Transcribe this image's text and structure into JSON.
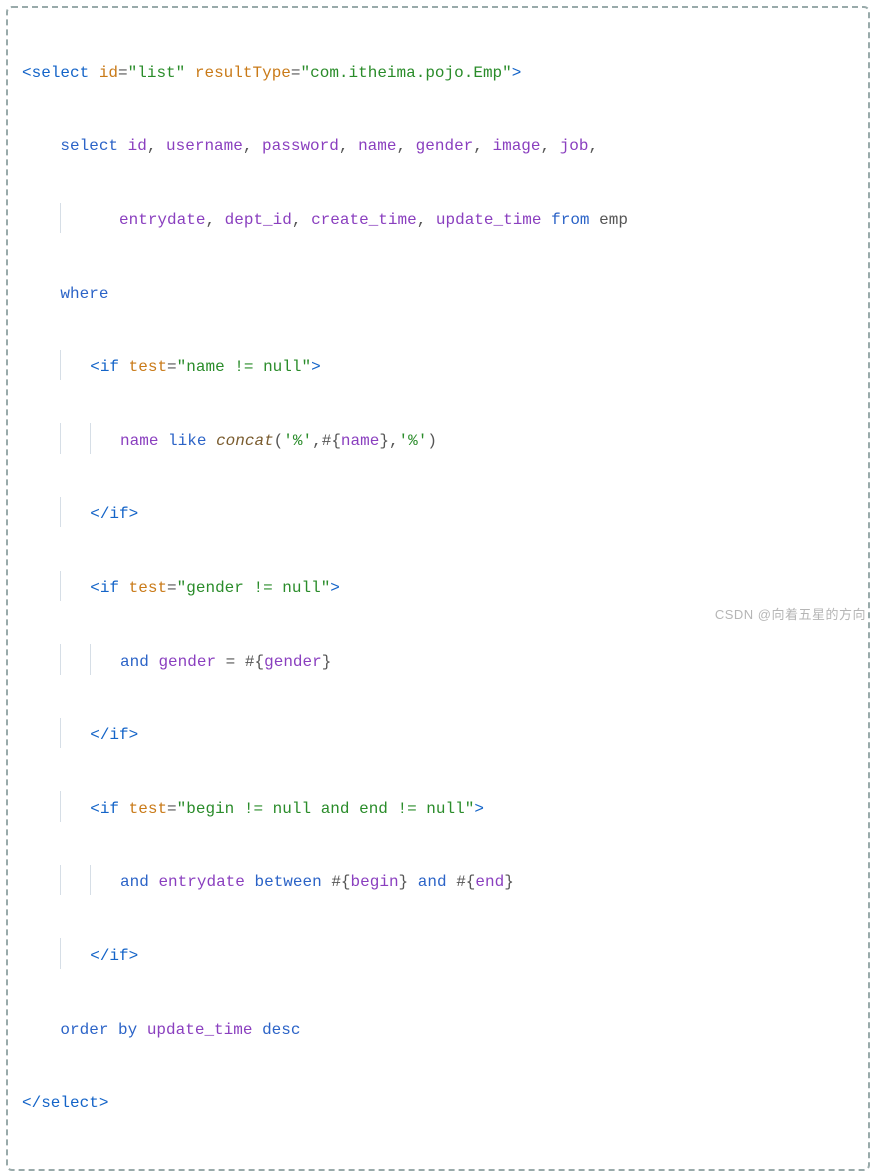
{
  "watermark": "CSDN @向着五星的方向",
  "l1": {
    "lt": "<",
    "select": "select",
    "sp": " ",
    "id_attr": "id",
    "eq": "=",
    "q": "\"",
    "id_val": "list",
    "sp2": " ",
    "rt_attr": "resultType",
    "rt_val": "com.itheima.pojo.Emp",
    "gt": ">"
  },
  "l2": {
    "indent": "    ",
    "select": "select",
    "sp": " ",
    "id": "id",
    "c": ", ",
    "user": "username",
    "pass": "password",
    "name": "name",
    "gender": "gender",
    "image": "image",
    "job": "job"
  },
  "l3": {
    "indent": "           ",
    "entry": "entrydate",
    "c": ", ",
    "dept": "dept_id",
    "ctime": "create_time",
    "utime": "update_time",
    "sp": " ",
    "from": "from",
    "sp2": " ",
    "emp": "emp"
  },
  "l4": {
    "indent": "    ",
    "where": "where"
  },
  "l5": {
    "indent": "        ",
    "lt": "<",
    "if": "if",
    "sp": " ",
    "test": "test",
    "eq": "=",
    "q": "\"",
    "cond": "name != null",
    "gt": ">"
  },
  "l6": {
    "indent": "            ",
    "name": "name",
    "sp": " ",
    "like": "like",
    "sp2": " ",
    "concat": "concat",
    "lp": "(",
    "s1": "'%'",
    "c": ",",
    "h": "#",
    "lb": "{",
    "nm": "name",
    "rb": "}",
    "s2": "'%'",
    "rp": ")"
  },
  "l7": {
    "indent": "        ",
    "lt": "</",
    "if": "if",
    "gt": ">"
  },
  "l8": {
    "indent": "        ",
    "lt": "<",
    "if": "if",
    "sp": " ",
    "test": "test",
    "eq": "=",
    "q": "\"",
    "cond": "gender != null",
    "gt": ">"
  },
  "l9": {
    "indent": "            ",
    "and": "and",
    "sp": " ",
    "gender": "gender",
    "sp2": " ",
    "eq": "=",
    "sp3": " ",
    "h": "#",
    "lb": "{",
    "g": "gender",
    "rb": "}"
  },
  "l10": {
    "indent": "        ",
    "lt": "</",
    "if": "if",
    "gt": ">"
  },
  "l11": {
    "indent": "        ",
    "lt": "<",
    "if": "if",
    "sp": " ",
    "test": "test",
    "eq": "=",
    "q": "\"",
    "cond": "begin != null and end != null",
    "gt": ">"
  },
  "l12": {
    "indent": "            ",
    "and": "and",
    "sp": " ",
    "entry": "entrydate",
    "sp2": " ",
    "btw": "between",
    "sp3": " ",
    "h1": "#",
    "lb1": "{",
    "b": "begin",
    "rb1": "}",
    "sp4": " ",
    "and2": "and",
    "sp5": " ",
    "h2": "#",
    "lb2": "{",
    "e": "end",
    "rb2": "}"
  },
  "l13": {
    "indent": "        ",
    "lt": "</",
    "if": "if",
    "gt": ">"
  },
  "l14": {
    "indent": "    ",
    "order": "order by",
    "sp": " ",
    "utime": "update_time",
    "sp2": " ",
    "desc": "desc"
  },
  "l15": {
    "lt": "</",
    "select": "select",
    "gt": ">"
  }
}
